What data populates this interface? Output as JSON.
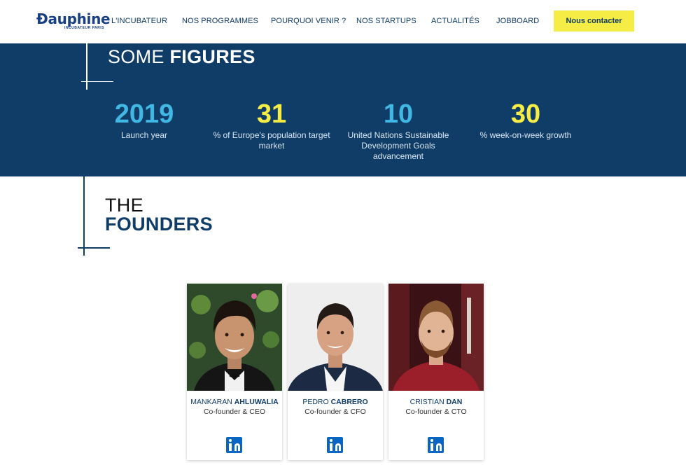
{
  "header": {
    "logo_text": "Ðauphine",
    "logo_sub": "INCUBATEUR PARIS",
    "nav": [
      {
        "label": "L'INCUBATEUR"
      },
      {
        "label": "NOS PROGRAMMES"
      },
      {
        "label": "POURQUOI VENIR ?"
      },
      {
        "label": "NOS STARTUPS"
      },
      {
        "label": "ACTUALITÉS"
      },
      {
        "label": "JOBBOARD"
      }
    ],
    "cta_label": "Nous contacter"
  },
  "figures": {
    "title_light": "SOME ",
    "title_bold": "FIGURES",
    "stats": [
      {
        "value": "2019",
        "label": "Launch year",
        "color": "#43b7e4"
      },
      {
        "value": "31",
        "label": "% of Europe's population target market",
        "color": "#f6ec46"
      },
      {
        "value": "10",
        "label": "United Nations Sustainable Development Goals advancement",
        "color": "#43b7e4"
      },
      {
        "value": "30",
        "label": "% week-on-week growth",
        "color": "#f6ec46"
      }
    ]
  },
  "founders": {
    "title_line1": "THE",
    "title_line2": "FOUNDERS",
    "people": [
      {
        "first": "MANKARAN ",
        "last": "AHLUWALIA",
        "role": "Co-founder & CEO",
        "icon": "linkedin-icon"
      },
      {
        "first": "PEDRO ",
        "last": "CABRERO",
        "role": "Co-founder & CFO",
        "icon": "linkedin-icon"
      },
      {
        "first": "CRISTIAN ",
        "last": "DAN",
        "role": "Co-founder & CTO",
        "icon": "linkedin-icon"
      }
    ]
  },
  "colors": {
    "navy": "#0f3d68",
    "accent_blue": "#43b7e4",
    "accent_yellow": "#f6ec46",
    "linkedin": "#0a66c2"
  }
}
